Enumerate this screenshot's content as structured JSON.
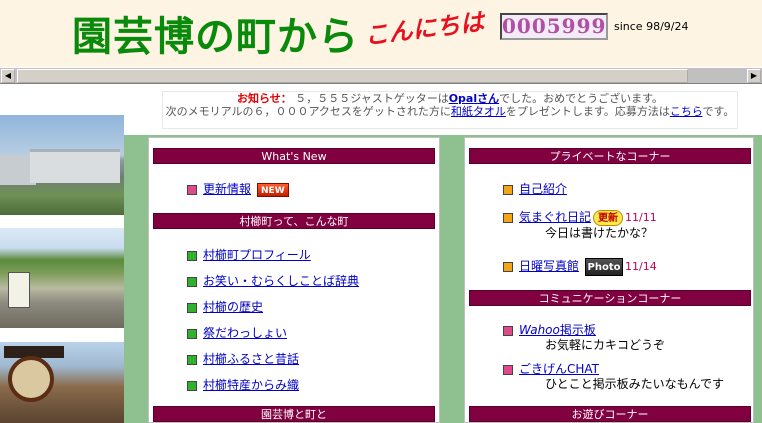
{
  "header": {
    "site_title": "園芸博の町から",
    "greeting": "こんにちは",
    "counter": "0005999",
    "since": "since 98/9/24"
  },
  "scrollbar": {
    "left_arrow": "◀",
    "right_arrow": "▶"
  },
  "notice": {
    "label": "お知らせ：",
    "line1_a": "５，５５５ジャストゲッターは",
    "line1_link": "Opalさん",
    "line1_b": "でした。おめでとうございます。",
    "line2_a": "次のメモリアルの６，０００アクセスをゲットされた方に",
    "line2_link": "和紙タオル",
    "line2_b": "をプレゼントします。応募方法は",
    "line2_link2": "こちら",
    "line2_c": "です。"
  },
  "left_column": {
    "sections": [
      {
        "title": "What's New"
      },
      {
        "title": "村櫛町って、こんな町"
      },
      {
        "title": "園芸博と町と"
      }
    ],
    "whats_new": {
      "label": "更新情報",
      "badge": "NEW"
    },
    "town_items": [
      {
        "label": "村櫛町プロフィール"
      },
      {
        "label": "お笑い・むらくしことば辞典"
      },
      {
        "label": "村櫛の歴史"
      },
      {
        "label": "祭だわっしょい"
      },
      {
        "label": "村櫛ふるさと昔話"
      },
      {
        "label": "村櫛特産からみ織"
      }
    ]
  },
  "right_column": {
    "sections": [
      {
        "title": "プライベートなコーナー"
      },
      {
        "title": "コミュニケーションコーナー"
      },
      {
        "title": "お遊びコーナー"
      }
    ],
    "private_items": [
      {
        "label": "自己紹介"
      },
      {
        "label": "気まぐれ日記",
        "badge": "更新",
        "date": "11/11",
        "sub": "今日は書けたかな？"
      },
      {
        "label": "日曜写真館",
        "badge": "Photo",
        "date": "11/14"
      }
    ],
    "comm_items": [
      {
        "label_italic": "Wahoo",
        "label": "掲示板",
        "sub": "お気軽にカキコどうぞ"
      },
      {
        "label": "ごきげんCHAT",
        "sub": "ひとこと掲示板みたいなもんです"
      }
    ]
  },
  "colors": {
    "title_green": "#0a8a0a",
    "greeting_red": "#e8101c",
    "section_header": "#800040",
    "background_green": "#8fc08f",
    "link_blue": "#0000c8",
    "date_color": "#c0005a"
  }
}
